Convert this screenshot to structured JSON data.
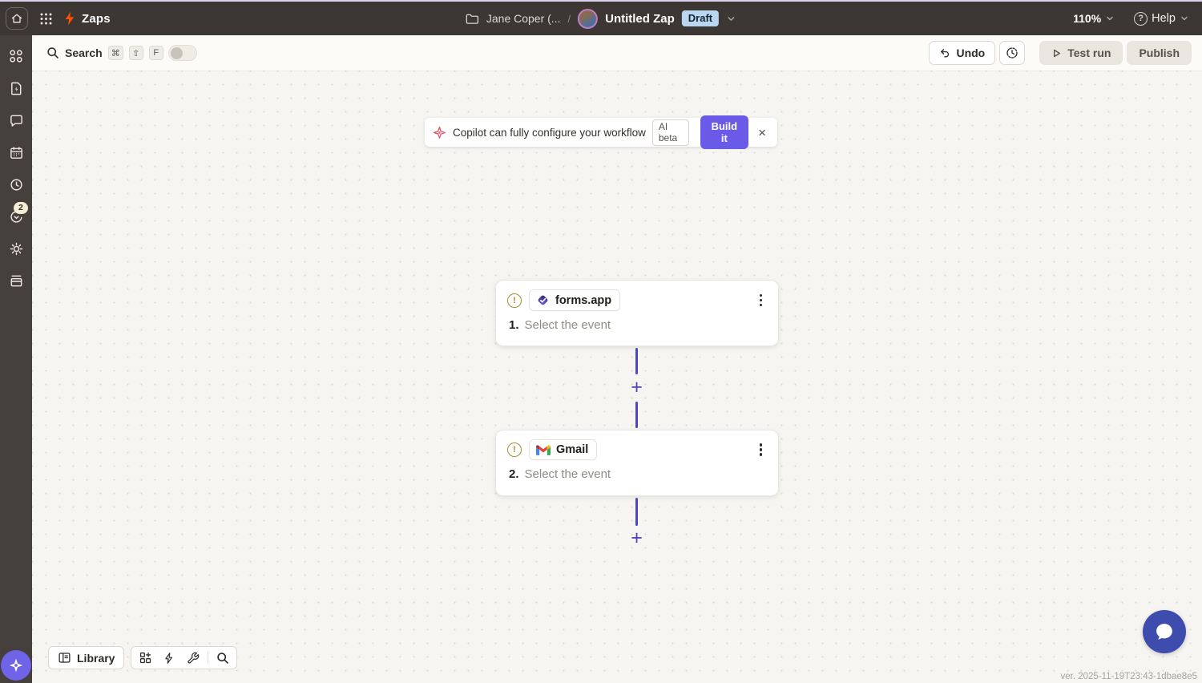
{
  "header": {
    "app_label": "Zaps",
    "breadcrumb": {
      "project_name": "Jane Coper (...",
      "separator": "/",
      "zap_name": "Untitled Zap",
      "status_badge": "Draft"
    },
    "zoom_level": "110%",
    "help_label": "Help"
  },
  "toolbar": {
    "search_label": "Search",
    "shortcut_keys": {
      "mod": "⌘",
      "shift": "⇧",
      "key": "F"
    },
    "undo_label": "Undo",
    "test_run_label": "Test run",
    "publish_label": "Publish"
  },
  "banner": {
    "message": "Copilot can fully configure your workflow",
    "beta_badge": "AI beta",
    "build_button": "Build it",
    "close_glyph": "×"
  },
  "steps": [
    {
      "app_name": "forms.app",
      "number": "1.",
      "event_placeholder": "Select the event",
      "warning_glyph": "!"
    },
    {
      "app_name": "Gmail",
      "number": "2.",
      "event_placeholder": "Select the event",
      "warning_glyph": "!"
    }
  ],
  "canvas": {
    "add_step_glyph": "+"
  },
  "sidebar": {
    "notification_count": "2"
  },
  "bottom_toolbar": {
    "library_label": "Library"
  },
  "footer": {
    "version_text": "ver. 2025-11-19T23:43-1dbae8e5"
  },
  "icons": {
    "header": [
      "home-icon",
      "app-grid-icon",
      "zap-bolt-icon",
      "folder-icon",
      "chevron-down-icon",
      "help-circle-icon"
    ],
    "sidebar": [
      "components-icon",
      "document-zap-icon",
      "chat-bubble-icon",
      "calendar-icon",
      "clock-icon",
      "gauge-refresh-icon",
      "gear-icon",
      "tray-stack-icon",
      "copilot-star-icon"
    ],
    "toolbar": [
      "search-icon",
      "undo-arrow-icon",
      "history-clock-icon",
      "play-icon"
    ],
    "bottom": [
      "library-book-icon",
      "blocks-add-icon",
      "lightning-icon",
      "wrench-icon",
      "magnifier-icon",
      "chat-bubble-icon"
    ]
  },
  "colors": {
    "accent_purple": "#695be8",
    "brand_orange": "#ff4f00",
    "connector_purple": "#5044c2",
    "draft_badge_bg": "#b9d7f1",
    "chat_button_blue": "#3e4cae",
    "header_bg": "#3d3733",
    "sidebar_bg": "#46403c",
    "canvas_bg": "#f6f5f1"
  }
}
